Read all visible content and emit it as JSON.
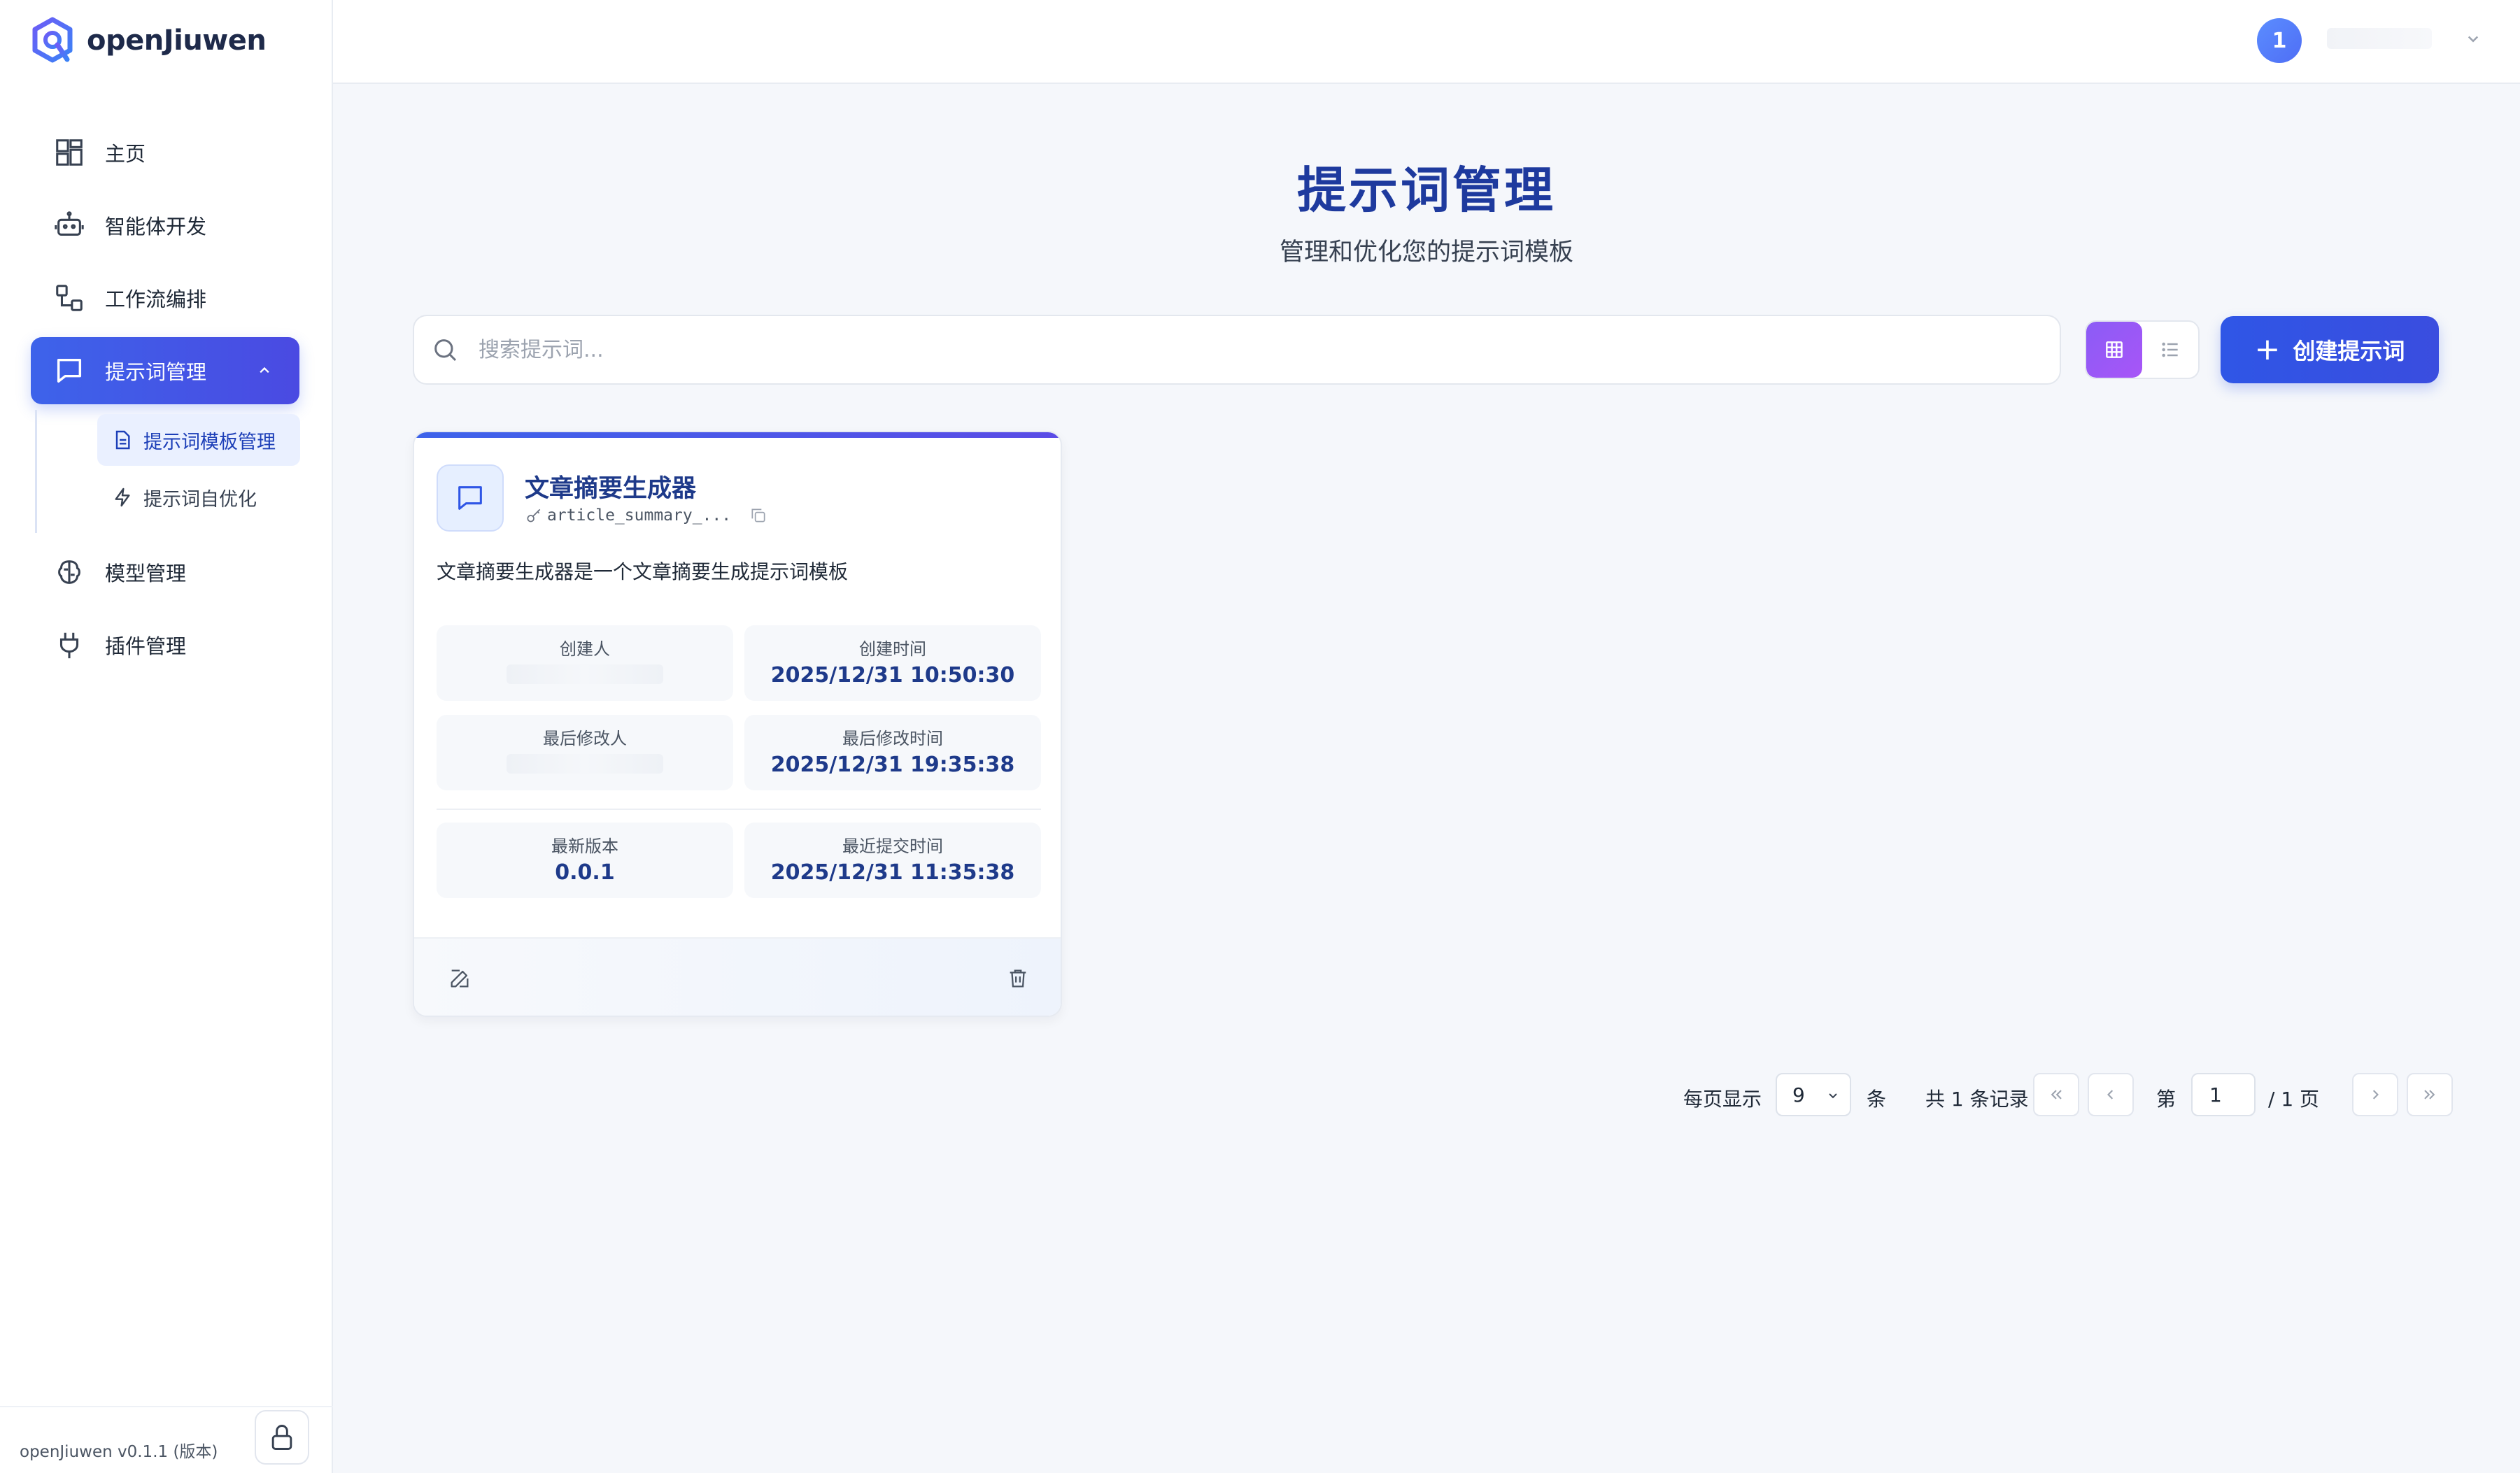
{
  "app": {
    "name": "openJiuwen",
    "version": "openJiuwen v0.1.1 (版本)"
  },
  "colors": {
    "accent": "#3d63ea",
    "title": "#1e3a9e",
    "purple": "#8b5cf6"
  },
  "sidebar": {
    "items": [
      {
        "label": "主页",
        "icon": "dashboard-icon"
      },
      {
        "label": "智能体开发",
        "icon": "robot-icon"
      },
      {
        "label": "工作流编排",
        "icon": "workflow-icon"
      },
      {
        "label": "提示词管理",
        "icon": "chat-icon",
        "active": true,
        "expanded": true
      },
      {
        "label": "模型管理",
        "icon": "brain-icon"
      },
      {
        "label": "插件管理",
        "icon": "plug-icon"
      }
    ],
    "subitems": [
      {
        "label": "提示词模板管理",
        "icon": "document-icon",
        "active": true
      },
      {
        "label": "提示词自优化",
        "icon": "lightning-icon"
      }
    ]
  },
  "header": {
    "avatar_initial": "1",
    "username": ""
  },
  "main": {
    "title": "提示词管理",
    "subtitle": "管理和优化您的提示词模板",
    "search_placeholder": "搜索提示词...",
    "create_button": "创建提示词"
  },
  "cards": [
    {
      "title": "文章摘要生成器",
      "key": "article_summary_...",
      "description": "文章摘要生成器是一个文章摘要生成提示词模板",
      "creator_label": "创建人",
      "created_time_label": "创建时间",
      "created_time": "2025/12/31 10:50:30",
      "modifier_label": "最后修改人",
      "modified_time_label": "最后修改时间",
      "modified_time": "2025/12/31 19:35:38",
      "version_label": "最新版本",
      "version": "0.0.1",
      "commit_time_label": "最近提交时间",
      "commit_time": "2025/12/31 11:35:38"
    }
  ],
  "pagination": {
    "per_page_label": "每页显示",
    "per_page": "9",
    "unit": "条",
    "total": "共 1 条记录",
    "page_prefix": "第",
    "current_page": "1",
    "page_suffix": "/ 1 页"
  }
}
